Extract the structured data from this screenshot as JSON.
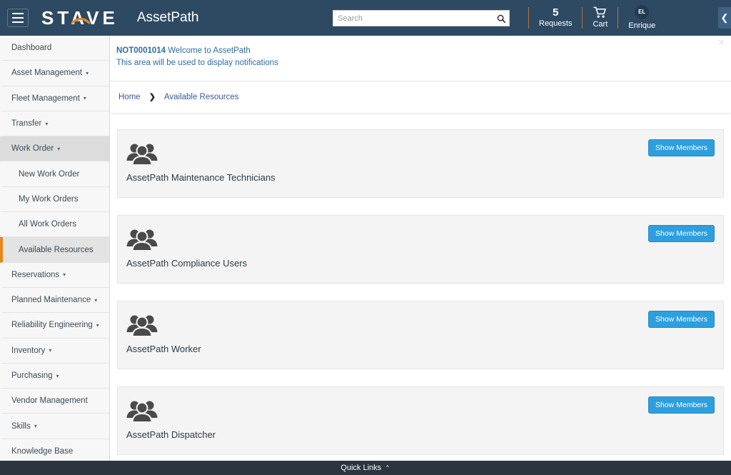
{
  "header": {
    "menu_icon": "hamburger-icon",
    "logo_text": "STAVE",
    "app_title": "AssetPath",
    "search": {
      "placeholder": "Search",
      "value": "",
      "icon": "search-icon"
    },
    "requests": {
      "count": "5",
      "label": "Requests"
    },
    "cart": {
      "label": "Cart",
      "icon": "cart-icon"
    },
    "user": {
      "initials": "EL",
      "name": "Enrique"
    },
    "collapse_icon": "chevron-left-icon"
  },
  "sidebar": {
    "items": [
      {
        "label": "Dashboard",
        "caret": "",
        "state": ""
      },
      {
        "label": "Asset Management",
        "caret": "▾",
        "state": ""
      },
      {
        "label": "Fleet Management",
        "caret": "▾",
        "state": ""
      },
      {
        "label": "Transfer",
        "caret": "▾",
        "state": ""
      },
      {
        "label": "Work Order",
        "caret": "▾",
        "state": "expanded"
      },
      {
        "label": "New Work Order",
        "caret": "",
        "state": "sub"
      },
      {
        "label": "My Work Orders",
        "caret": "",
        "state": "sub"
      },
      {
        "label": "All Work Orders",
        "caret": "",
        "state": "sub"
      },
      {
        "label": "Available Resources",
        "caret": "",
        "state": "sub active"
      },
      {
        "label": "Reservations",
        "caret": "▾",
        "state": ""
      },
      {
        "label": "Planned Maintenance",
        "caret": "▾",
        "state": ""
      },
      {
        "label": "Reliability Engineering",
        "caret": "▾",
        "state": ""
      },
      {
        "label": "Inventory",
        "caret": "▾",
        "state": ""
      },
      {
        "label": "Purchasing",
        "caret": "▾",
        "state": ""
      },
      {
        "label": "Vendor Management",
        "caret": "",
        "state": ""
      },
      {
        "label": "Skills",
        "caret": "▾",
        "state": ""
      },
      {
        "label": "Knowledge Base",
        "caret": "",
        "state": ""
      }
    ]
  },
  "notification": {
    "id": "NOT0001014",
    "title": "Welcome to AssetPath",
    "body": "This area will be used to display notifications",
    "close_icon": "close-icon"
  },
  "breadcrumb": {
    "home": "Home",
    "separator": "❯",
    "current": "Available Resources"
  },
  "resources": {
    "button_label": "Show Members",
    "icon": "group-users-icon",
    "cards": [
      {
        "title": "AssetPath Maintenance Technicians"
      },
      {
        "title": "AssetPath Compliance Users"
      },
      {
        "title": "AssetPath Worker"
      },
      {
        "title": "AssetPath Dispatcher"
      }
    ]
  },
  "footer": {
    "label": "Quick Links",
    "caret": "⌃"
  },
  "colors": {
    "header_bg": "#2e4a63",
    "accent_orange": "#e8861e",
    "button_blue": "#2e9fde",
    "footer_bg": "#2b3540",
    "link_blue": "#2e6da4"
  }
}
